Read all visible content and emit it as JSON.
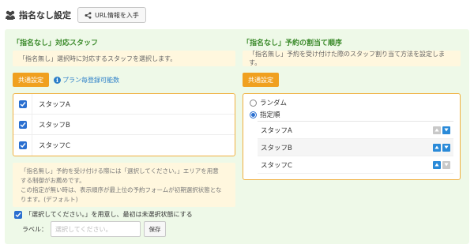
{
  "header": {
    "title": "指名なし設定",
    "url_button_label": "URL情報を入手"
  },
  "left": {
    "title": "「指名なし」対応スタッフ",
    "note": "「指名無し」選択時に対応するスタッフを選択します。",
    "common_button": "共通設定",
    "plan_link": "プラン毎登録可能数",
    "staff": [
      {
        "name": "スタッフA",
        "checked": true
      },
      {
        "name": "スタッフB",
        "checked": true
      },
      {
        "name": "スタッフC",
        "checked": true
      }
    ],
    "warn_lines": [
      "「指名無し」予約を受け付ける際には「選択してください。」エリアを用意",
      "する制御がお薦めです。",
      "この指定が無い時は、表示順序が最上位の予約フォームが初期選択状態とな",
      "ります。(デフォルト)"
    ],
    "placeholder_checkbox_label": "「選択してください。」を用意し、最初は未選択状態にする",
    "label_caption": "ラベル：",
    "label_placeholder": "選択してください。",
    "save_button": "保存"
  },
  "right": {
    "title": "「指名なし」予約の割当て順序",
    "note": "「指名無し」予約を受け付けた際のスタッフ割り当て方法を設定します。",
    "common_button": "共通設定",
    "options": [
      {
        "label": "ランダム",
        "selected": false
      },
      {
        "label": "指定順",
        "selected": true
      }
    ],
    "order": [
      {
        "name": "スタッフA",
        "up": false,
        "down": true
      },
      {
        "name": "スタッフB",
        "up": true,
        "down": true
      },
      {
        "name": "スタッフC",
        "up": true,
        "down": false
      }
    ]
  },
  "colors": {
    "panel_bg": "#eef9e8",
    "title_green": "#3a8a2a",
    "accent_orange": "#f0a020",
    "checkbox_blue": "#2a6fd0"
  }
}
